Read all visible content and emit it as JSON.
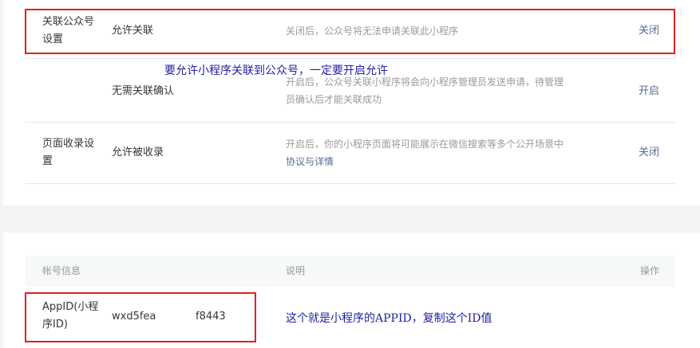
{
  "settings": {
    "rows": [
      {
        "label": "关联公众号设置",
        "setting": "允许关联",
        "desc": "关闭后，公众号将无法申请关联此小程序",
        "action": "关闭"
      },
      {
        "label": "",
        "setting": "无需关联确认",
        "desc": "开启后，公众号关联小程序将会向小程序管理员发送申请，待管理员确认后才能关联成功",
        "action": "开启"
      },
      {
        "label": "页面收录设置",
        "setting": "允许被收录",
        "desc": "开启后，你的小程序页面将可能展示在微信搜索等多个公开场景中",
        "link": "协议与详情",
        "action": "关闭"
      }
    ]
  },
  "account": {
    "headers": {
      "info": "帐号信息",
      "desc": "说明",
      "ops": "操作"
    },
    "appid_label": "AppID(小程序ID)",
    "appid_value_start": "wxd5fea",
    "appid_value_end": "f8443"
  },
  "annotations": {
    "allow_hint": "要允许小程序关联到公众号，一定要开启允许",
    "appid_hint": "这个就是小程序的APPID，复制这个ID值"
  },
  "colors": {
    "link": "#576b95",
    "highlight_box": "#e02020",
    "annotation_text": "#1f1fa6"
  }
}
